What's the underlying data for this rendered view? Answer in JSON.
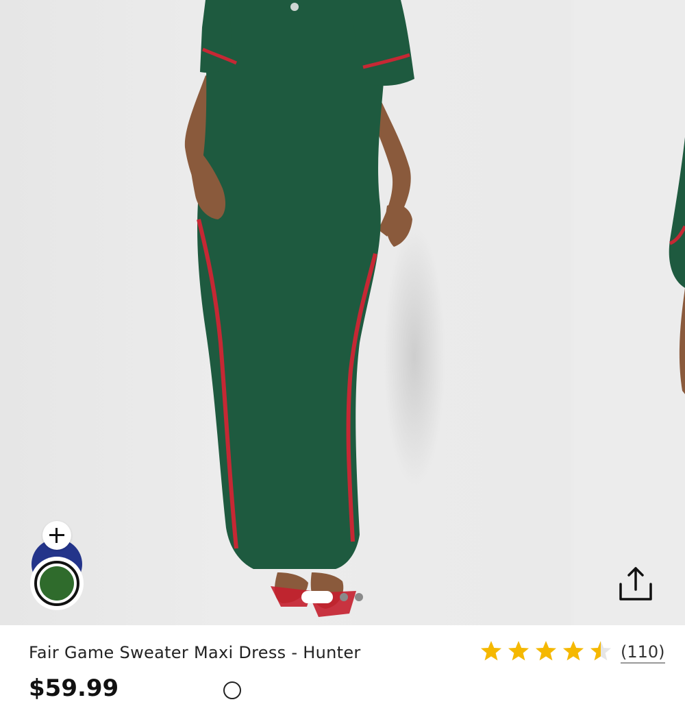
{
  "product": {
    "title": "Fair Game Sweater Maxi Dress - Hunter",
    "reviews_count": "(110)",
    "rating": 4.5,
    "price": "$59.99"
  },
  "colors": {
    "dress": "#1e5a3f",
    "stripe": "#c62834",
    "swatch_selected": "#2f6b2c",
    "swatch_alt": "#23348a",
    "star": "#f5b800"
  },
  "gallery": {
    "slide_count": 3,
    "active_slide": 1
  },
  "icons": {
    "add": "plus-icon",
    "share": "share-icon",
    "star": "star-icon"
  }
}
